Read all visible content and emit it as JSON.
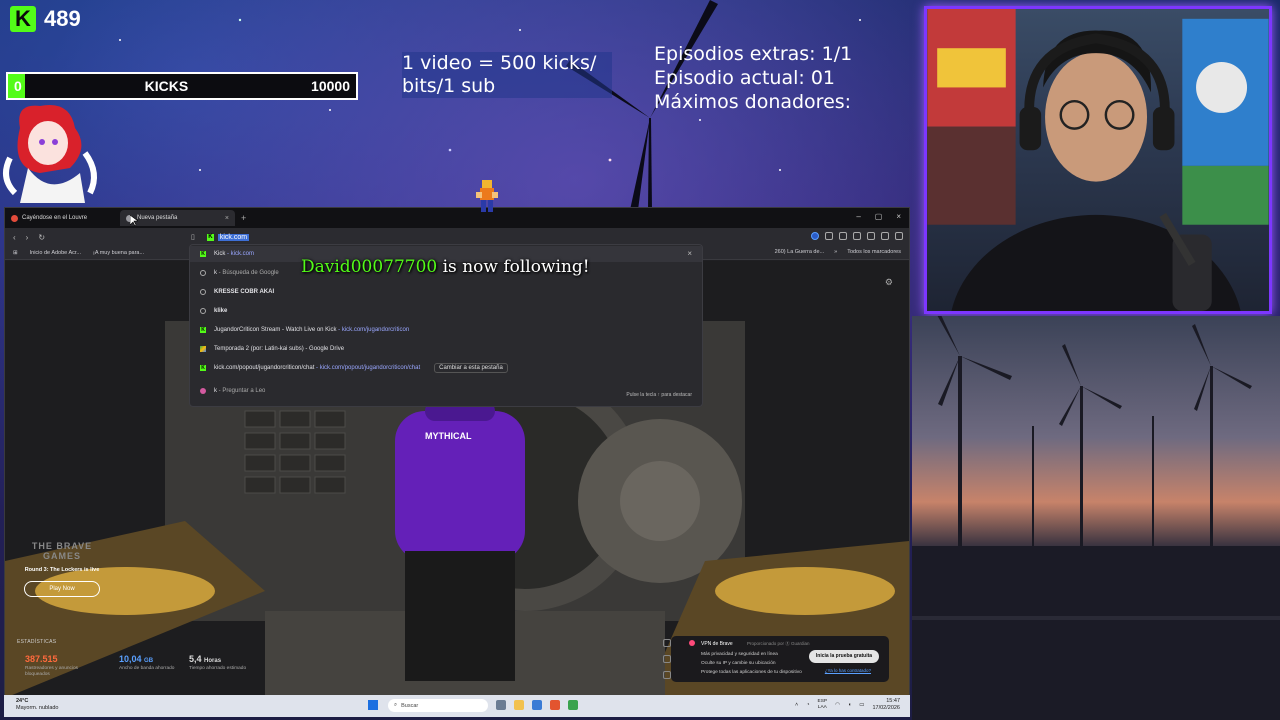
{
  "overlay": {
    "kick_count": "489",
    "kick_logo_letter": "K",
    "kicks_bar": {
      "min": "0",
      "label": "KICKS",
      "max": "10000",
      "progress_fraction": 0.0489
    },
    "promo_text": "1 video = 500 kicks/ bits/1 sub",
    "episodes": {
      "extras": "Episodios extras: 1/1",
      "actual": "Episodio actual: 01",
      "donors": "Máximos donadores:"
    },
    "follow_alert": {
      "user": "David00077700",
      "message": " is now following!"
    },
    "colors": {
      "kick_green": "#53fc18",
      "webcam_border": "#7d36ff"
    }
  },
  "browser": {
    "tabs": [
      {
        "title": "Cayéndose en el Louvre",
        "favicon": "red-circle"
      },
      {
        "title": "Nueva pestaña",
        "favicon": "grey-circle",
        "close": "×"
      }
    ],
    "new_tab": "+",
    "window_controls": [
      "–",
      "▢",
      "×"
    ],
    "url": "kick.com",
    "bookmarks": [
      "Inicio de Adobe Acr...",
      "¡A muy buena para...",
      "260) La Guerra de..."
    ],
    "all_bookmarks": "Todos los marcadores",
    "omnibox": {
      "rows": [
        {
          "icon": "kick",
          "text": "Kick",
          "sub": " - kick.com"
        },
        {
          "icon": "search",
          "text": "k",
          "sub": " - Búsqueda de Google"
        },
        {
          "icon": "history",
          "text": "KRESSE COBR AKAI",
          "sub": ""
        },
        {
          "icon": "history",
          "text": "klike",
          "sub": ""
        },
        {
          "icon": "kick",
          "text": "JugandorCriticon Stream - Watch Live on Kick",
          "sub": " - kick.com/jugandorcriticon"
        },
        {
          "icon": "drive",
          "text": "Temporada 2 (por: Latin-kai subs) - Google Drive",
          "sub": ""
        },
        {
          "icon": "kick",
          "text": "kick.com/popout/jugandorcriticon/chat",
          "sub": " - kick.com/popout/jugandorcriticon/chat"
        },
        {
          "icon": "leo",
          "text": "k",
          "sub": " - Preguntar a Leo"
        }
      ],
      "switch_tab": "Cambiar a esta pestaña",
      "hint": "Pulse la tecla ↑ para destacar"
    },
    "page": {
      "brave_games": {
        "logo": "THE BRAVE GAMES",
        "round": "Round 3: The Lockers is live",
        "play": "Play Now"
      },
      "hoodie_text": "MYTHICAL",
      "stats": {
        "title": "ESTADÍSTICAS",
        "items": [
          {
            "value": "387.515",
            "unit": "",
            "label": "Rastreadores y anuncios bloqueados",
            "color": "#ff6a3d"
          },
          {
            "value": "10,04",
            "unit": "GB",
            "label": "Ancho de banda ahorrado",
            "color": "#5aa0ff"
          },
          {
            "value": "5,4",
            "unit": "Horas",
            "label": "Tiempo ahorrado estimado",
            "color": "#ffffff"
          }
        ]
      },
      "vpn": {
        "title": "VPN de Brave",
        "sponsor": "Proporcionado por ⓖ Guardian",
        "bullets": [
          "Más privacidad y seguridad en línea",
          "Oculte su IP y cambie su ubicación",
          "Protege todas las aplicaciones de tu dispositivo"
        ],
        "cta": "Inicia la prueba gratuita",
        "link": "¿Ya lo has contratado?"
      }
    }
  },
  "taskbar": {
    "weather_temp": "24°C",
    "weather_desc": "Mayorm. nublado",
    "search": "Buscar",
    "lang_top": "ESP",
    "lang_bottom": "LAA",
    "time": "15:47",
    "date": "17/02/2026"
  }
}
